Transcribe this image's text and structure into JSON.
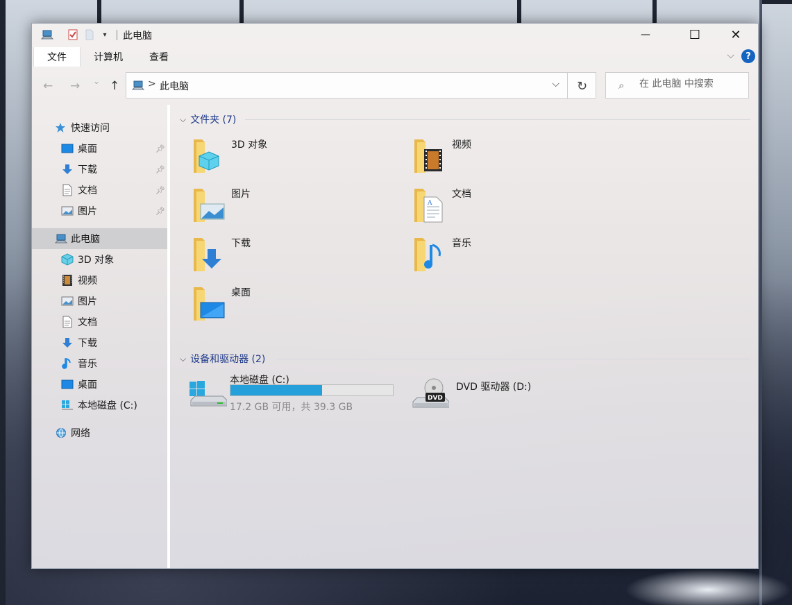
{
  "window": {
    "title": "此电脑",
    "minimize_label": "—",
    "maximize_label": "☐",
    "close_label": "✕"
  },
  "ribbon": {
    "tabs": [
      "文件",
      "计算机",
      "查看"
    ],
    "help_label": "?"
  },
  "navigation": {
    "back_glyph": "←",
    "forward_glyph": "→",
    "recent_glyph": "⌄",
    "up_glyph": "↑",
    "address_path": "此电脑",
    "address_sep": ">",
    "refresh_glyph": "↻",
    "search_placeholder": "在 此电脑 中搜索"
  },
  "sidebar": {
    "quick_access": "快速访问",
    "pinned": [
      {
        "label": "桌面",
        "icon": "desktop-icon"
      },
      {
        "label": "下载",
        "icon": "download-icon"
      },
      {
        "label": "文档",
        "icon": "document-icon"
      },
      {
        "label": "图片",
        "icon": "picture-icon"
      }
    ],
    "this_pc": "此电脑",
    "pc_items": [
      {
        "label": "3D 对象",
        "icon": "3d-objects-icon"
      },
      {
        "label": "视频",
        "icon": "video-icon"
      },
      {
        "label": "图片",
        "icon": "picture-icon"
      },
      {
        "label": "文档",
        "icon": "document-icon"
      },
      {
        "label": "下载",
        "icon": "download-icon"
      },
      {
        "label": "音乐",
        "icon": "music-icon"
      },
      {
        "label": "桌面",
        "icon": "desktop-icon"
      },
      {
        "label": "本地磁盘 (C:)",
        "icon": "local-disk-icon"
      }
    ],
    "network": "网络"
  },
  "content": {
    "folders_header": "文件夹 (7)",
    "folders": [
      {
        "label": "3D 对象",
        "icon": "3d-objects-folder-icon"
      },
      {
        "label": "视频",
        "icon": "video-folder-icon"
      },
      {
        "label": "图片",
        "icon": "picture-folder-icon"
      },
      {
        "label": "文档",
        "icon": "document-folder-icon"
      },
      {
        "label": "下载",
        "icon": "download-folder-icon"
      },
      {
        "label": "音乐",
        "icon": "music-folder-icon"
      },
      {
        "label": "桌面",
        "icon": "desktop-folder-icon"
      }
    ],
    "devices_header": "设备和驱动器 (2)",
    "drives": [
      {
        "label": "本地磁盘 (C:)",
        "free_text": "17.2 GB 可用，共 39.3 GB",
        "used_fraction": 0.562,
        "icon": "windows-drive-icon"
      },
      {
        "label": "DVD 驱动器 (D:)",
        "icon": "dvd-drive-icon",
        "badge": "DVD"
      }
    ]
  },
  "colors": {
    "accent": "#26a0da",
    "header_text": "#1e3a8a",
    "folder_yellow": "#f7d674",
    "help_blue": "#1565c0"
  }
}
